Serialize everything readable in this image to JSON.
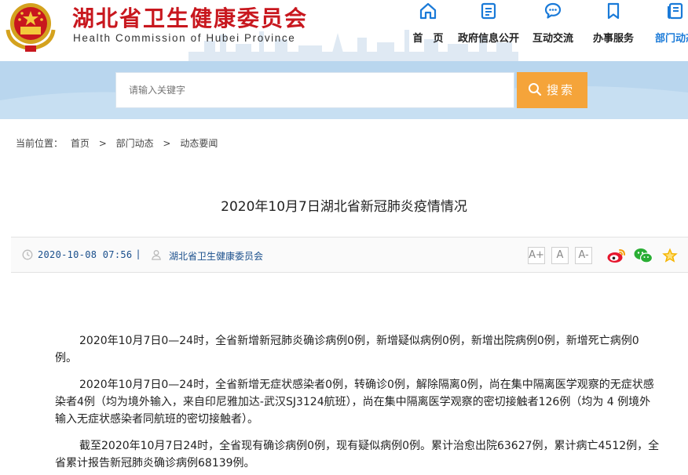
{
  "header": {
    "site_title": "湖北省卫生健康委员会",
    "site_subtitle": "Health Commission of Hubei Province",
    "nav": [
      {
        "label": "首　页",
        "icon": "home-icon"
      },
      {
        "label": "政府信息公开",
        "icon": "document-icon"
      },
      {
        "label": "互动交流",
        "icon": "chat-bubble-icon"
      },
      {
        "label": "办事服务",
        "icon": "bookmark-icon"
      },
      {
        "label": "部门动态",
        "icon": "news-icon"
      }
    ]
  },
  "search": {
    "placeholder": "请输入关键字",
    "button_label": "搜索"
  },
  "breadcrumb": {
    "prefix": "当前位置：",
    "items": [
      "首页",
      "部门动态",
      "动态要闻"
    ],
    "separator": ">"
  },
  "article": {
    "title": "2020年10月7日湖北省新冠肺炎疫情情况",
    "date": "2020-10-08 07:56",
    "divider": "|",
    "source": "湖北省卫生健康委员会",
    "font_buttons": [
      "A+",
      "A",
      "A-"
    ],
    "share": [
      "weibo-icon",
      "wechat-icon",
      "favorite-star-icon"
    ],
    "paragraphs": [
      "2020年10月7日0—24时，全省新增新冠肺炎确诊病例0例，新增疑似病例0例，新增出院病例0例，新增死亡病例0例。",
      "2020年10月7日0—24时，全省新增无症状感染者0例，转确诊0例，解除隔离0例，尚在集中隔离医学观察的无症状感染者4例（均为境外输入，来自印尼雅加达-武汉SJ3124航班），尚在集中隔离医学观察的密切接触者126例（均为 4 例境外输入无症状感染者同航班的密切接触者）。",
      "截至2020年10月7日24时，全省现有确诊病例0例，现有疑似病例0例。累计治愈出院63627例，累计病亡4512例，全省累计报告新冠肺炎确诊病例68139例。"
    ]
  },
  "colors": {
    "brand_red": "#c8171e",
    "nav_active": "#1a7ad8",
    "search_band": "#b9d6ee",
    "search_button": "#f5a43a",
    "meta_text": "#1a4f8c"
  }
}
